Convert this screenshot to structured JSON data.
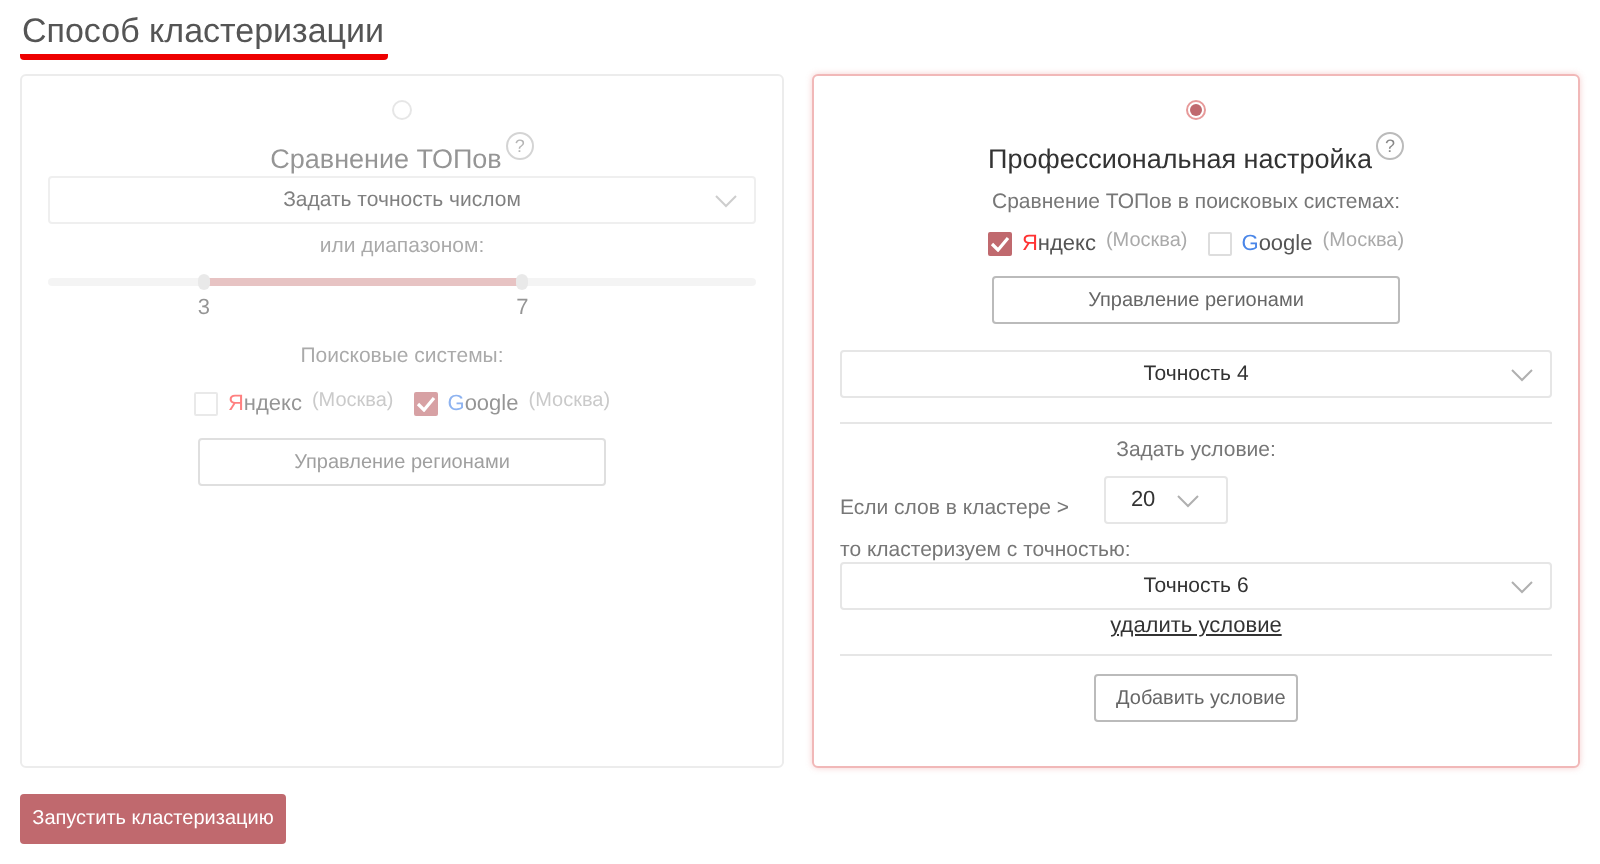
{
  "title": "Способ кластеризации",
  "methods": [
    {
      "kind": "simple",
      "selected": false,
      "title": "Сравнение ТОПов",
      "help": "?",
      "precision_select": {
        "value": "Задать точность числом"
      },
      "range_label": "или диапазоном:",
      "range": {
        "thumbs": [
          {
            "level": 0.22,
            "label": "3"
          },
          {
            "level": 0.67,
            "label": "7"
          }
        ]
      },
      "engines_label": "Поисковые системы:",
      "engines": [
        {
          "kind": "yandex",
          "name": "Яндекс",
          "region": "(Москва)",
          "checked": false
        },
        {
          "kind": "google",
          "name": "Google",
          "region": "(Москва)",
          "checked": true
        }
      ],
      "regions_button": "Управление регионами"
    },
    {
      "kind": "pro",
      "selected": true,
      "title": "Профессиональная настройка",
      "help": "?",
      "engines_label": "Сравнение ТОПов в поисковых системах:",
      "engines": [
        {
          "kind": "yandex",
          "name": "Яндекс",
          "region": "(Москва)",
          "checked": true
        },
        {
          "kind": "google",
          "name": "Google",
          "region": "(Москва)",
          "checked": false
        }
      ],
      "regions_button": "Управление регионами",
      "precision_select": {
        "value": "Точность 4"
      },
      "condition_label": "Задать условие:",
      "conditions": [
        {
          "if_label": "Если слов в кластере >",
          "count": "20",
          "then_label": "то кластеризуем с точностью:",
          "precision": "Точность 6",
          "delete_link": "удалить условие"
        }
      ],
      "add_button": "Добавить условие"
    }
  ],
  "run_button": "Запустить кластеризацию"
}
